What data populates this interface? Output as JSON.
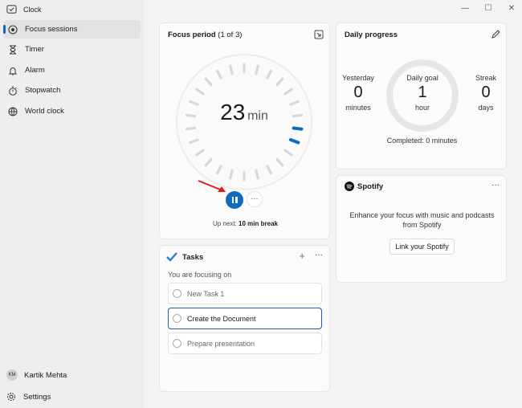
{
  "app": {
    "title": "Clock"
  },
  "nav": {
    "items": [
      {
        "label": "Focus sessions",
        "icon": "focus-icon",
        "active": true
      },
      {
        "label": "Timer",
        "icon": "hourglass-icon"
      },
      {
        "label": "Alarm",
        "icon": "bell-icon"
      },
      {
        "label": "Stopwatch",
        "icon": "stopwatch-icon"
      },
      {
        "label": "World clock",
        "icon": "globe-icon"
      }
    ]
  },
  "profile": {
    "initials": "KM",
    "name": "Kartik Mehta"
  },
  "settings": {
    "label": "Settings"
  },
  "window": {
    "minimize": "—",
    "maximize": "☐",
    "close": "✕"
  },
  "focus": {
    "title": "Focus period",
    "period": "(1 of 3)",
    "minutes": "23",
    "unit": "min",
    "up_next_prefix": "Up next:",
    "up_next_value": "10 min break",
    "more": "···"
  },
  "tasks": {
    "title": "Tasks",
    "add": "+",
    "more": "···",
    "focusing_label": "You are focusing on",
    "items": [
      {
        "label": "New Task 1"
      },
      {
        "label": "Create the Document",
        "active": true
      },
      {
        "label": "Prepare presentation"
      }
    ]
  },
  "progress": {
    "title": "Daily progress",
    "yesterday": {
      "label": "Yesterday",
      "value": "0",
      "unit": "minutes"
    },
    "goal": {
      "label": "Daily goal",
      "value": "1",
      "unit": "hour"
    },
    "streak": {
      "label": "Streak",
      "value": "0",
      "unit": "days"
    },
    "completed": "Completed: 0 minutes"
  },
  "spotify": {
    "title": "Spotify",
    "more": "···",
    "description": "Enhance your focus with music and podcasts from Spotify",
    "button": "Link your Spotify"
  },
  "colors": {
    "accent": "#0f6cbd",
    "arrow": "#e02020"
  }
}
